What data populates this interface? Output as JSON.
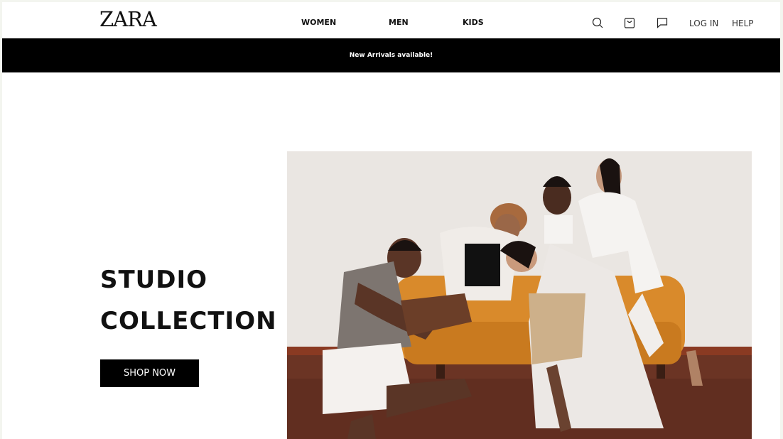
{
  "brand": {
    "logo": "ZARA"
  },
  "nav": {
    "links": [
      "WOMEN",
      "MEN",
      "KIDS"
    ],
    "login": "LOG IN",
    "help": "HELP"
  },
  "icons": {
    "search": "search-icon",
    "bag": "shopping-bag-icon",
    "chat": "chat-icon"
  },
  "banner": {
    "text": "New Arrivals available!"
  },
  "hero": {
    "title_line1": "STUDIO",
    "title_line2": "COLLECTION",
    "button_label": "SHOP NOW",
    "image": "photo of five women in neutral clothing lounging on an orange sofa"
  },
  "colors": {
    "banner_bg": "#000000",
    "button_bg": "#000000",
    "sofa_accent": "#d98a2b"
  }
}
